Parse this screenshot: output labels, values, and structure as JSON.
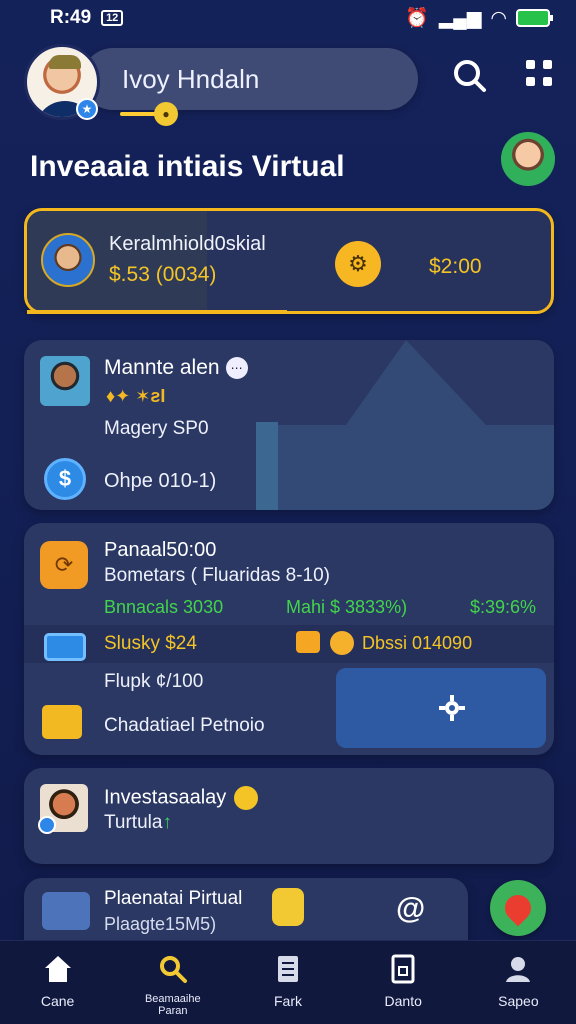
{
  "status_bar": {
    "time": "R:49",
    "notification_badge": "12"
  },
  "header": {
    "user_name": "Ivoy Hndaln",
    "page_title": "Inveaaia intiais Virtual"
  },
  "cards": {
    "featured": {
      "title": "Keralmhiold0skial",
      "value": "$.53 (0034)",
      "price": "$2:00",
      "progress_fraction": 0.5
    },
    "profile": {
      "name": "Mannte alen",
      "tags": "♦✦ ✶ƨI",
      "meta": "Magery SP0",
      "bottom": "Ohpe 010-1)"
    },
    "portfolio": {
      "title": "Panaal50:00",
      "subtitle": "Bometars ( Fluaridas 8-10)",
      "stat1": "Bnnacals 3030",
      "stat2": "Mahi $ 3833%)",
      "stat3": "$:39:6%",
      "study": "Slusky $24",
      "gift_label": "Dbssi 014090",
      "flash": "Flupk ¢/100",
      "perf": "Chadatiael Petnoio"
    },
    "investment": {
      "title": "Investasaalay",
      "subtitle": "Turtula"
    },
    "plan": {
      "title": "Plaenatai Pirtual",
      "sub": "Plaagte15M5)"
    }
  },
  "bottom_nav": [
    {
      "label": "Cane"
    },
    {
      "label": "Beamaaihe",
      "sub": "Paran"
    },
    {
      "label": "Fark"
    },
    {
      "label": "Danto"
    },
    {
      "label": "Sapeo"
    }
  ],
  "colors": {
    "background": "#14225a",
    "card": "#2a3863",
    "accent_gold": "#f4c426",
    "positive_green": "#42d44b",
    "fab_green": "#3cb25a"
  },
  "icons": {
    "search": "search-icon",
    "menu": "grid-menu-icon",
    "settings": "gear-icon",
    "home": "home-icon",
    "search_nav": "search-icon",
    "book": "book-icon",
    "document": "document-icon",
    "profile": "profile-icon"
  }
}
